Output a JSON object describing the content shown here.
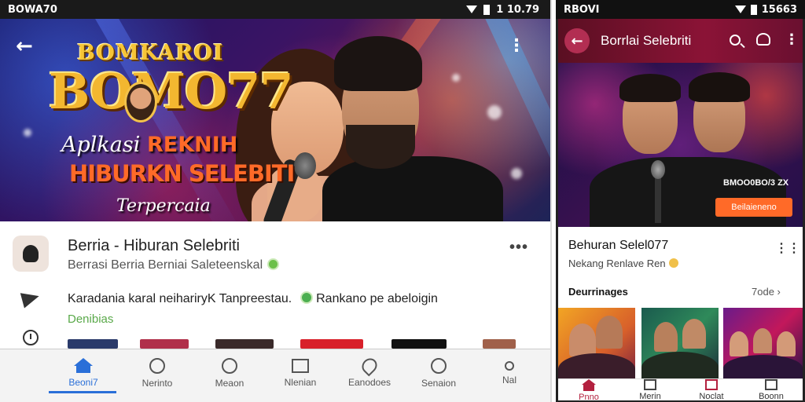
{
  "left_phone": {
    "status": {
      "left_text": "BOWA70",
      "time": "1 10.79"
    },
    "hero": {
      "logo_top": "BOMKAROI",
      "logo_main": "BOMO77",
      "tagline_1a": "Aplkasi",
      "tagline_1b": "REKNIH",
      "tagline_2": "HIBURKN SELEBITI",
      "tagline_3": "Terpercaia"
    },
    "app": {
      "title": "Berria - Hiburan Selebriti",
      "subtitle": "Berrasi Berria  Berniai Saleteenskal",
      "description_a": "Karadania karal neihariryK Tanpreestau.",
      "description_b": "Rankano pe abeloigin",
      "green_link": "Denibias"
    },
    "thumb_colors": [
      "#2a3a6a",
      "#b0304a",
      "#3a2a2a",
      "#d8202a",
      "#111111",
      "#a0604a"
    ],
    "nav": [
      {
        "label": "Beoni7",
        "icon": "home-icon"
      },
      {
        "label": "Nerinto",
        "icon": "compass-icon"
      },
      {
        "label": "Meaon",
        "icon": "shield-icon"
      },
      {
        "label": "Nlenian",
        "icon": "document-icon"
      },
      {
        "label": "Eanodoes",
        "icon": "heart-icon"
      },
      {
        "label": "Senaion",
        "icon": "chat-icon"
      },
      {
        "label": "Nal",
        "icon": "person-icon"
      }
    ],
    "accent": "#2a6fd8"
  },
  "right_phone": {
    "status": {
      "left_text": "RBOVI",
      "time": "15663"
    },
    "appbar_title": "Borrlai Selebriti",
    "hero": {
      "overlay_text": "BMOO0BO/3 ZX",
      "button": "Beilaieneno"
    },
    "info": {
      "title": "Behuran Selel077",
      "subtitle": "Nekang  Renlave Ren"
    },
    "section": {
      "title": "Deurrinages",
      "link": "7ode ›"
    },
    "nav": [
      {
        "label": "Pnno",
        "icon": "home-icon"
      },
      {
        "label": "Merin",
        "icon": "grid-icon"
      },
      {
        "label": "Noclat",
        "icon": "square-icon"
      },
      {
        "label": "Boonn",
        "icon": "upload-icon"
      }
    ],
    "accent": "#b3213f"
  }
}
